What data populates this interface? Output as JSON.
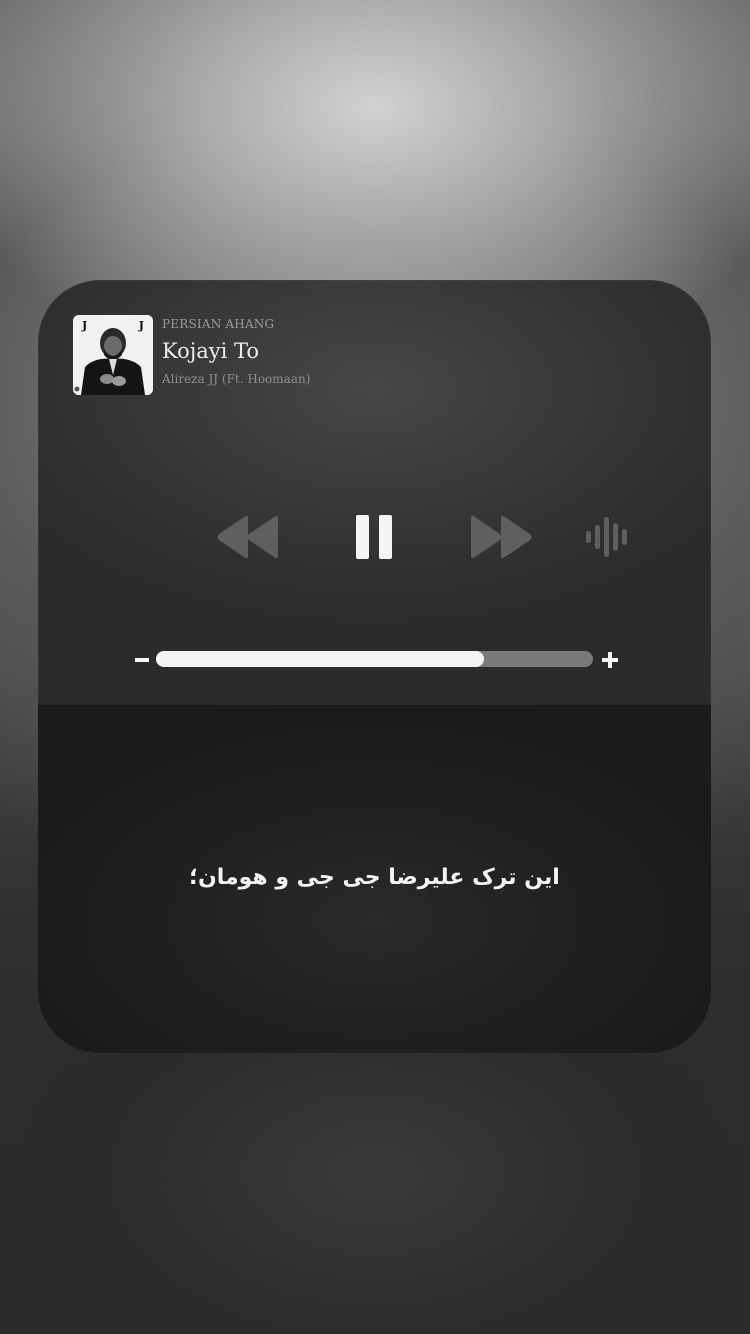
{
  "player": {
    "source_label": "PERSIAN AHANG",
    "track_title": "Kojayi To",
    "artist": "Alireza JJ (Ft. Hoomaan)",
    "album_art": {
      "letters": [
        "J",
        "J"
      ],
      "description_icon": "album-cover-image"
    },
    "controls": {
      "rewind_icon": "rewind-icon",
      "pause_icon": "pause-icon",
      "forward_icon": "fast-forward-icon",
      "audio_icon": "sound-wave-icon"
    },
    "volume": {
      "minus_label": "-",
      "plus_label": "+",
      "level": 0.75
    }
  },
  "caption": "این ترک علیرضا جی جی و هومان؛",
  "colors": {
    "card_top": "#323232",
    "card_bottom": "#1f1f1f",
    "control_gray": "#5f5f5f",
    "control_white": "#f5f5f5",
    "slider_track": "#7a7a7a",
    "slider_fill": "#f5f5f5"
  }
}
